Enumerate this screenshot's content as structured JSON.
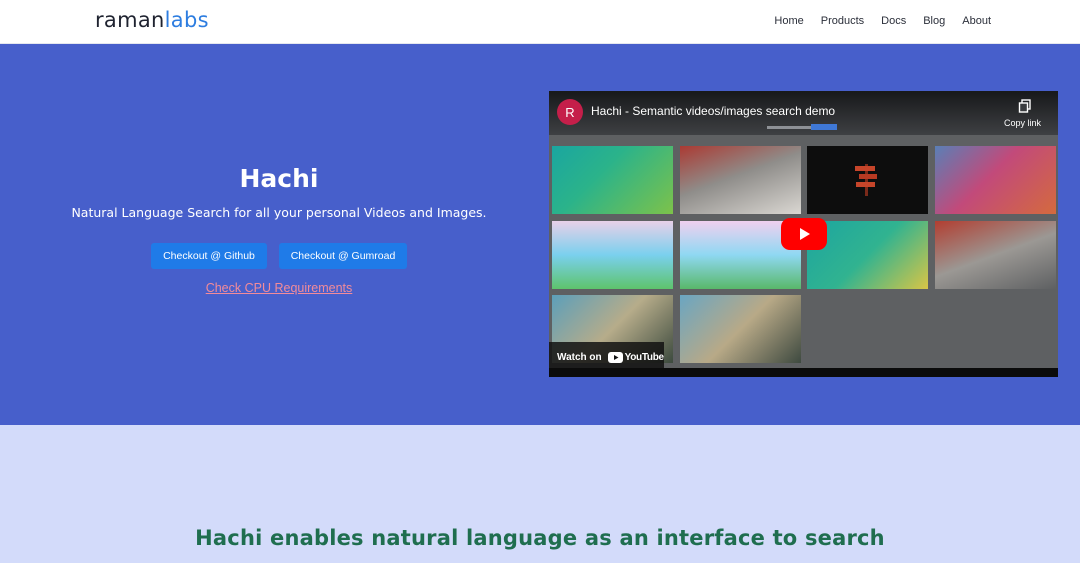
{
  "navbar": {
    "logo_part1": "raman",
    "logo_part2": "labs",
    "links": [
      "Home",
      "Products",
      "Docs",
      "Blog",
      "About"
    ]
  },
  "hero": {
    "title": "Hachi",
    "subtitle": "Natural Language Search for all your personal Videos and Images.",
    "buttons": {
      "github": "Checkout @ Github",
      "gumroad": "Checkout @ Gumroad"
    },
    "cpu_link": "Check CPU Requirements"
  },
  "video": {
    "channel_initial": "R",
    "title": "Hachi - Semantic videos/images search demo",
    "copy_label": "Copy link",
    "watch_on": "Watch on",
    "platform": "YouTube",
    "icons": [
      "copy-icon",
      "play-icon",
      "youtube-logo-icon"
    ]
  },
  "lower": {
    "heading": "Hachi enables natural language as an interface to search"
  },
  "colors": {
    "hero_bg": "#475fcb",
    "button_bg": "#1f7be8",
    "link_pink": "#f28b9a",
    "lower_bg": "#d3dbfa",
    "heading_green": "#1f6e4f",
    "logo_blue": "#2d7de0"
  }
}
